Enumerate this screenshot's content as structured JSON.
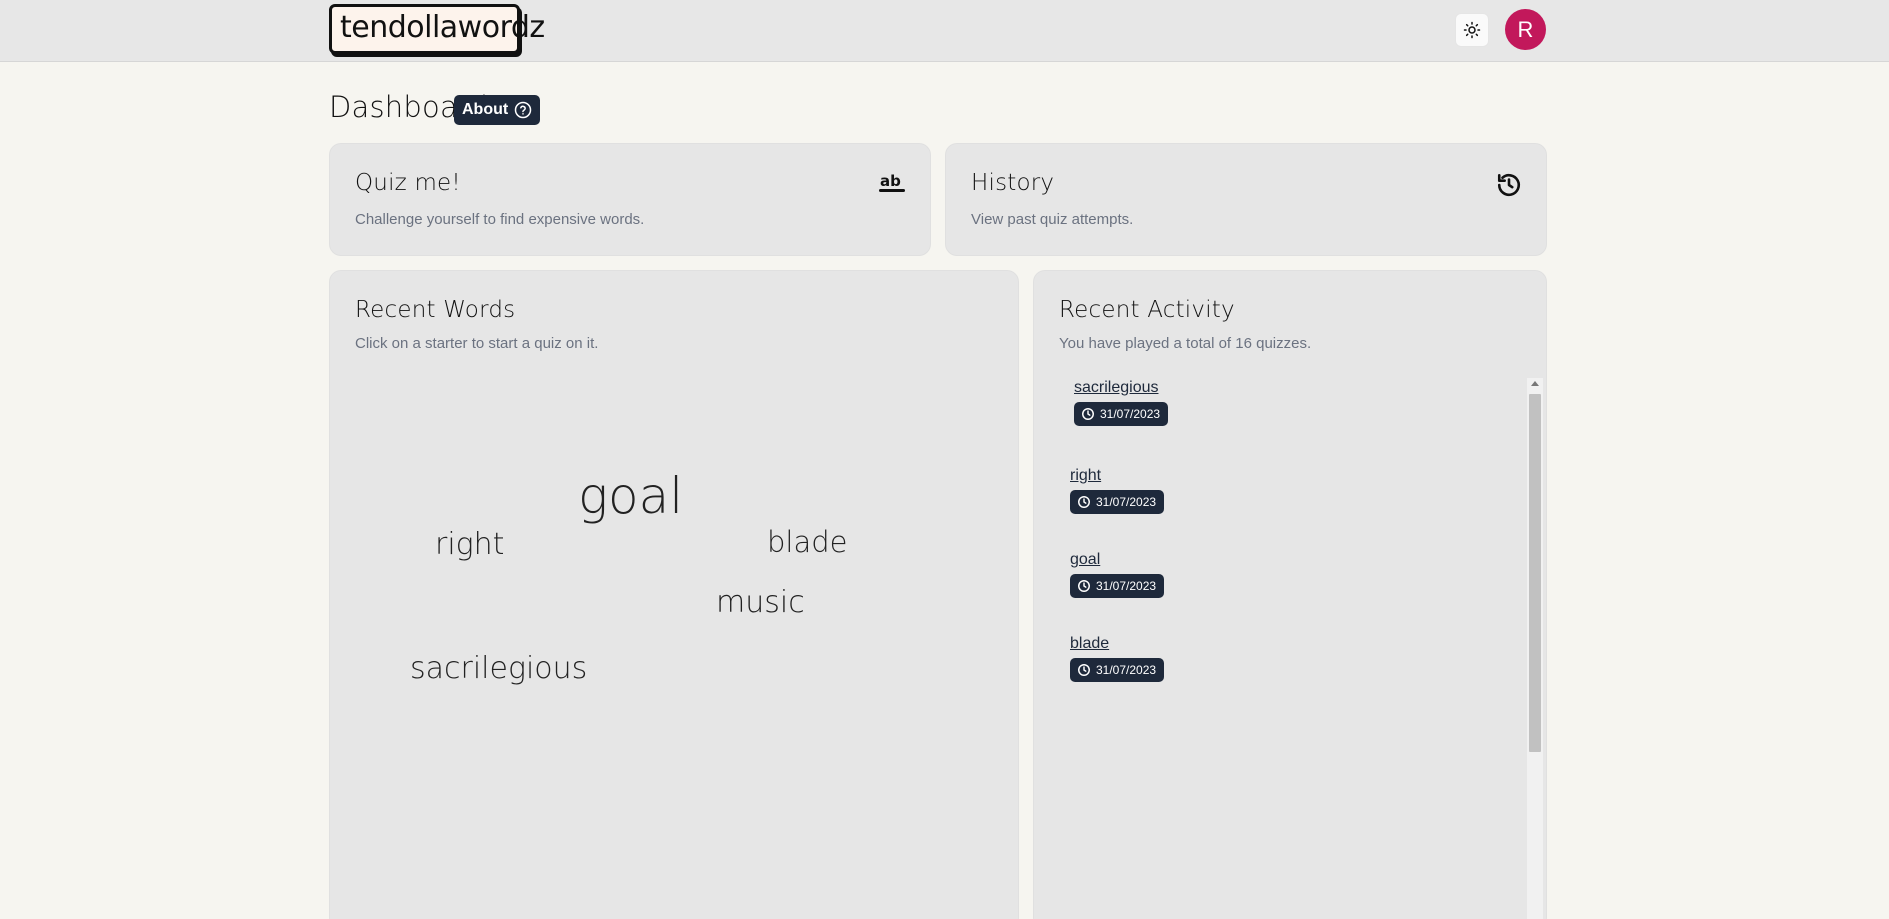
{
  "header": {
    "logo": "tendollawordz",
    "avatar_initial": "R"
  },
  "page": {
    "title": "Dashboard",
    "about_label": "About"
  },
  "quiz_card": {
    "title": "Quiz me!",
    "subtitle": "Challenge yourself to find expensive words."
  },
  "history_card": {
    "title": "History",
    "subtitle": "View past quiz attempts."
  },
  "recent_words": {
    "title": "Recent Words",
    "subtitle": "Click on a starter to start a quiz on it.",
    "words": [
      "goal",
      "right",
      "blade",
      "music",
      "sacrilegious"
    ]
  },
  "recent_activity": {
    "title": "Recent Activity",
    "subtitle": "You have played a total of 16 quizzes.",
    "items": [
      {
        "word": "sacrilegious",
        "date": "31/07/2023"
      },
      {
        "word": "right",
        "date": "31/07/2023"
      },
      {
        "word": "goal",
        "date": "31/07/2023"
      },
      {
        "word": "blade",
        "date": "31/07/2023"
      }
    ]
  },
  "colors": {
    "accent": "#1e293b",
    "avatar": "#c2185b",
    "background": "#f6f5f0",
    "card": "#e6e6e6"
  },
  "icons": {
    "theme_toggle": "sun-icon",
    "about": "question-circle-icon",
    "quiz": "spell-check-icon",
    "history": "history-icon",
    "date": "clock-icon"
  }
}
